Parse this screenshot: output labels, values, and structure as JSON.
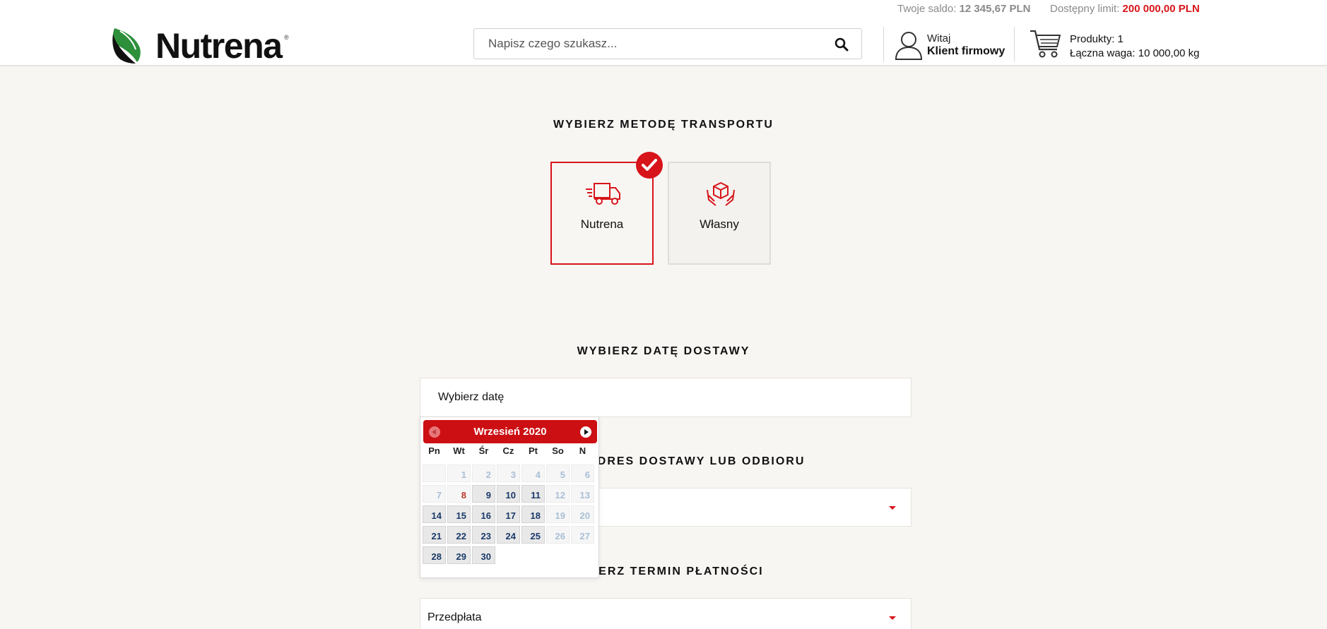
{
  "header": {
    "balance_label": "Twoje saldo:",
    "balance_value": "12 345,67 PLN",
    "limit_label": "Dostępny limit:",
    "limit_value": "200 000,00 PLN",
    "logo_text": "Nutrena",
    "logo_mark": "®",
    "search_placeholder": "Napisz czego szukasz...",
    "user_greeting": "Witaj",
    "user_name": "Klient firmowy",
    "cart_products": "Produkty: 1",
    "cart_weight": "Łączna waga: 10 000,00 kg"
  },
  "transport": {
    "title": "WYBIERZ METODĘ TRANSPORTU",
    "options": [
      {
        "label": "Nutrena",
        "icon": "truck-icon",
        "selected": true
      },
      {
        "label": "Własny",
        "icon": "hands-box-icon",
        "selected": false
      }
    ]
  },
  "delivery_date": {
    "title": "WYBIERZ DATĘ DOSTAWY",
    "placeholder": "Wybierz datę"
  },
  "address": {
    "title": "WYBIERZ ADRES DOSTAWY LUB ODBIORU",
    "value": ""
  },
  "payment": {
    "title": "WYBIERZ TERMIN PŁATNOŚCI",
    "value": "Przedpłata"
  },
  "datepicker": {
    "month_label": "Wrzesień 2020",
    "weekdays": [
      "Pn",
      "Wt",
      "Śr",
      "Cz",
      "Pt",
      "So",
      "N"
    ],
    "first_weekday_offset": 1,
    "days_in_month": 30,
    "today": 8,
    "enabled_days": [
      9,
      10,
      11,
      14,
      15,
      16,
      17,
      18,
      21,
      22,
      23,
      24,
      25,
      28,
      29,
      30
    ]
  },
  "colors": {
    "accent": "#d7141a",
    "background": "#f8f6f3"
  }
}
